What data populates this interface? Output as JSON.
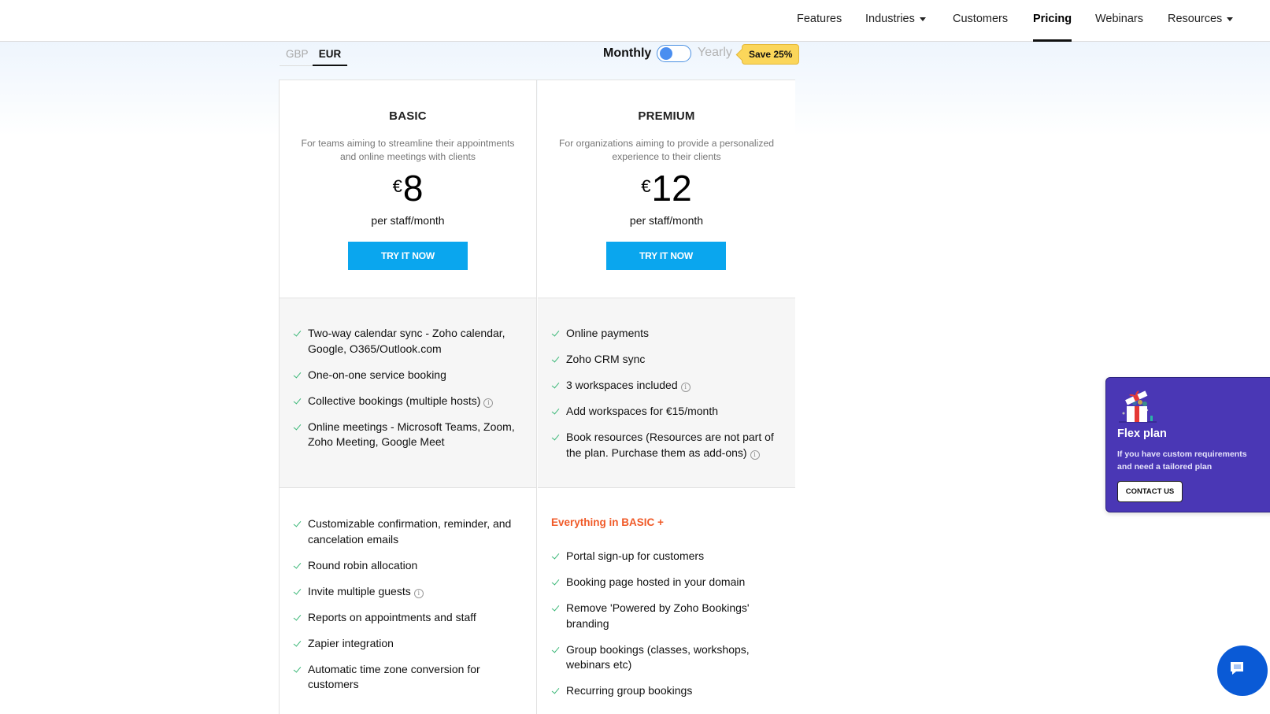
{
  "nav": {
    "items": [
      {
        "label": "Features",
        "dropdown": false,
        "active": false
      },
      {
        "label": "Industries",
        "dropdown": true,
        "active": false
      },
      {
        "label": "Customers",
        "dropdown": false,
        "active": false
      },
      {
        "label": "Pricing",
        "dropdown": false,
        "active": true
      },
      {
        "label": "Webinars",
        "dropdown": false,
        "active": false
      },
      {
        "label": "Resources",
        "dropdown": true,
        "active": false
      }
    ]
  },
  "currency": {
    "options": [
      "GBP",
      "EUR"
    ],
    "selected": "EUR"
  },
  "billing": {
    "monthly_label": "Monthly",
    "yearly_label": "Yearly",
    "selected": "Monthly",
    "save_badge": "Save 25%"
  },
  "plans": [
    {
      "name": "BASIC",
      "description": "For teams aiming to streamline their appointments and online meetings with clients",
      "currency_symbol": "€",
      "price": "8",
      "per": "per staff/month",
      "cta": "TRY IT NOW",
      "features_core": [
        {
          "text": "Two-way calendar sync - Zoho calendar, Google, O365/Outlook.com",
          "info": false
        },
        {
          "text": "One-on-one service booking",
          "info": false
        },
        {
          "text": "Collective bookings (multiple hosts)",
          "info": true
        },
        {
          "text": "Online meetings - Microsoft Teams, Zoom, Zoho Meeting, Google Meet",
          "info": false
        }
      ],
      "features_extra_heading": "",
      "features_extra": [
        {
          "text": "Customizable confirmation, reminder, and cancelation emails",
          "info": false
        },
        {
          "text": "Round robin allocation",
          "info": false
        },
        {
          "text": "Invite multiple guests",
          "info": true
        },
        {
          "text": "Reports on appointments and staff",
          "info": false
        },
        {
          "text": "Zapier integration",
          "info": false
        },
        {
          "text": "Automatic time zone conversion for customers",
          "info": false
        }
      ]
    },
    {
      "name": "PREMIUM",
      "description": "For organizations aiming to provide a personalized experience to their clients",
      "currency_symbol": "€",
      "price": "12",
      "per": "per staff/month",
      "cta": "TRY IT NOW",
      "features_core": [
        {
          "text": "Online payments",
          "info": false
        },
        {
          "text": "Zoho CRM sync",
          "info": false
        },
        {
          "text": "3 workspaces included",
          "info": true
        },
        {
          "text": "Add workspaces for €15/month",
          "info": false
        },
        {
          "text": "Book resources (Resources are not part of the plan. Purchase them as add-ons)",
          "info": true
        }
      ],
      "features_extra_heading": "Everything in BASIC +",
      "features_extra": [
        {
          "text": "Portal sign-up for customers",
          "info": false
        },
        {
          "text": "Booking page hosted in your domain",
          "info": false
        },
        {
          "text": "Remove 'Powered by Zoho Bookings' branding",
          "info": false
        },
        {
          "text": "Group bookings (classes, workshops, webinars etc)",
          "info": false
        },
        {
          "text": "Recurring group bookings",
          "info": false
        }
      ]
    }
  ],
  "flex_plan": {
    "icon": "gift-icon",
    "title": "Flex plan",
    "description_lines": [
      "If you have custom requirements",
      "and need a tailored plan"
    ],
    "cta": "CONTACT US"
  },
  "chat": {
    "icon": "chat-icon"
  },
  "colors": {
    "accent_button": "#0aa6ee",
    "check": "#3cb878",
    "highlight_heading": "#f05a28",
    "flex_card": "#4a37b5",
    "save_badge": "#fbd65a",
    "chat_button": "#0a5ad6"
  }
}
